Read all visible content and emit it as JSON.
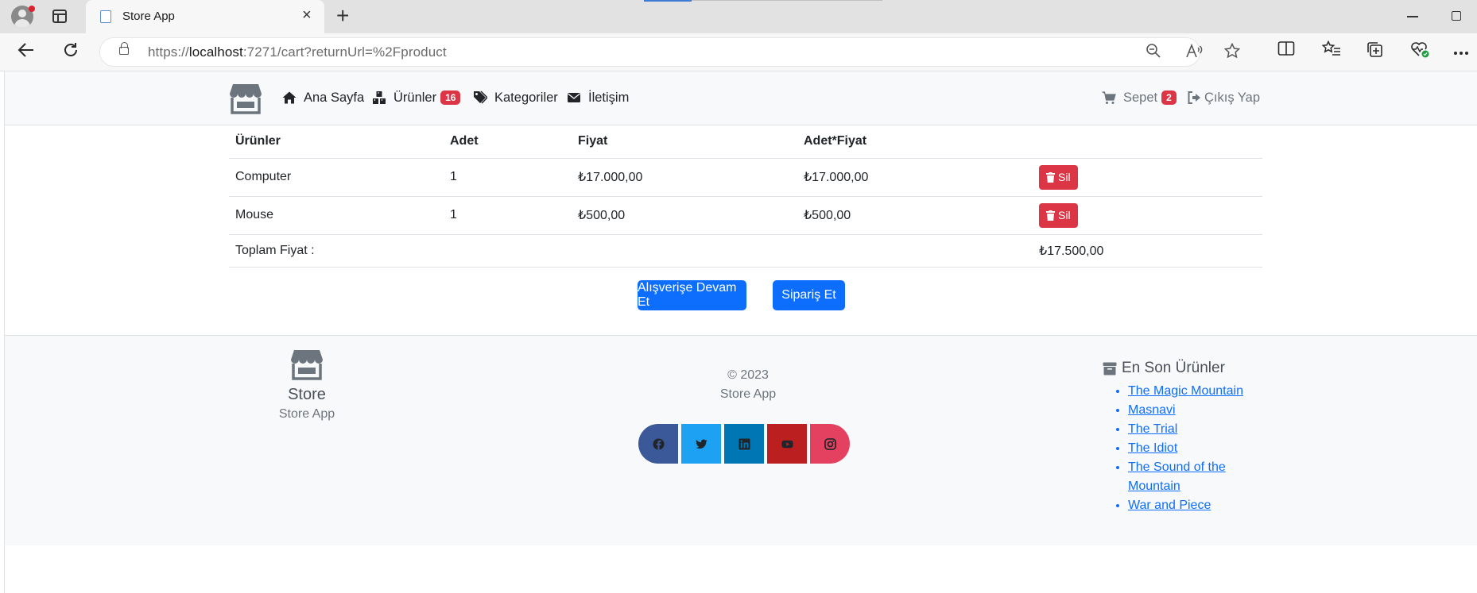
{
  "browser": {
    "tab_title": "Store App",
    "tab_close": "×",
    "new_tab": "+",
    "url_scheme": "https://",
    "url_host": "localhost",
    "url_rest": ":7271/cart?returnUrl=%2Fproduct"
  },
  "navbar": {
    "items": [
      {
        "label": "Ana Sayfa",
        "icon": "home-icon"
      },
      {
        "label": "Ürünler",
        "icon": "boxes-icon",
        "badge": "16"
      },
      {
        "label": "Kategoriler",
        "icon": "tags-icon"
      },
      {
        "label": "İletişim",
        "icon": "envelope-icon"
      }
    ],
    "cart_label": "Sepet",
    "cart_badge": "2",
    "logout_label": "Çıkış Yap"
  },
  "cart": {
    "headers": [
      "Ürünler",
      "Adet",
      "Fiyat",
      "Adet*Fiyat",
      ""
    ],
    "rows": [
      {
        "product": "Computer",
        "quantity": "1",
        "price": "₺17.000,00",
        "subtotal": "₺17.000,00",
        "action": "Sil"
      },
      {
        "product": "Mouse",
        "quantity": "1",
        "price": "₺500,00",
        "subtotal": "₺500,00",
        "action": "Sil"
      }
    ],
    "total_label": "Toplam Fiyat :",
    "total_value": "₺17.500,00",
    "continue_button": "Alışverişe Devam Et",
    "order_button": "Sipariş Et"
  },
  "footer": {
    "brand_title": "Store",
    "brand_subtitle": "Store App",
    "copyright": "© 2023",
    "copyright_sub": "Store App",
    "socials": [
      "facebook-icon",
      "twitter-icon",
      "linkedin-icon",
      "youtube-icon",
      "instagram-icon"
    ],
    "latest_title": "En Son Ürünler",
    "latest_items": [
      "The Magic Mountain",
      "Masnavi",
      "The Trial",
      "The Idiot",
      "The Sound of the Mountain",
      "War and Piece"
    ]
  },
  "colors": {
    "primary": "#0d6efd",
    "danger": "#dc3545",
    "light": "#f8f9fa"
  }
}
